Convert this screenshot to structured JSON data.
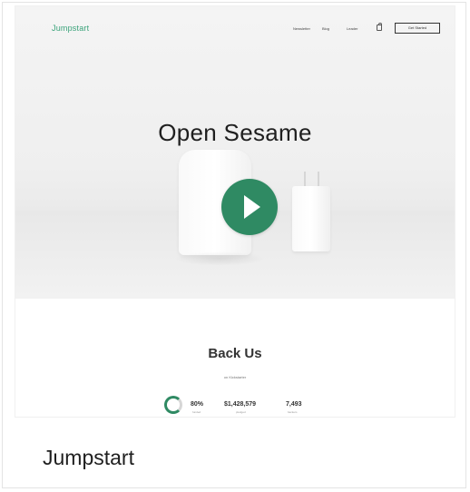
{
  "site": {
    "logo": "Jumpstart",
    "nav": {
      "links": [
        "Newsletter",
        "Blog",
        "Leader"
      ],
      "cta_label": "Get Started"
    },
    "hero": {
      "title": "Open Sesame",
      "accent_color": "#2f8a63"
    },
    "back_us": {
      "title": "Back Us",
      "subtitle": "on Kickstarter",
      "stats": [
        {
          "value": "80%",
          "label": "funded"
        },
        {
          "value": "$1,428,579",
          "label": "pledged"
        },
        {
          "value": "7,493",
          "label": "backers"
        }
      ]
    }
  },
  "caption": "Jumpstart",
  "icons": [
    "play-icon",
    "shopping-bag-icon",
    "progress-ring-icon"
  ]
}
